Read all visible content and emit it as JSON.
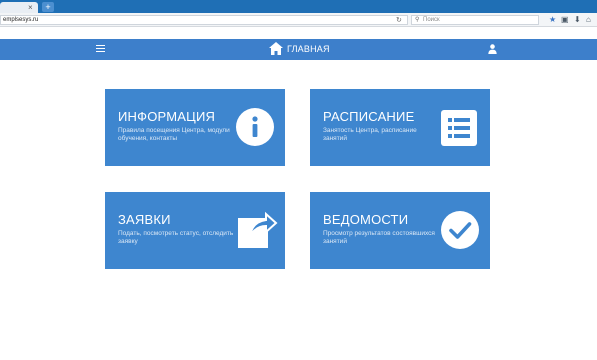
{
  "browser": {
    "tab_close": "×",
    "new_tab": "+",
    "url": "emplsesys.ru",
    "search_placeholder": "Поиск",
    "reload": "↻"
  },
  "header": {
    "title": "ГЛАВНАЯ",
    "menu_icon": "hamburger-icon",
    "home_icon": "home-icon",
    "user_icon": "user-icon"
  },
  "cards": [
    {
      "title": "ИНФОРМАЦИЯ",
      "description": "Правила посещения Центра, модули обучения, контакты",
      "icon": "info-icon"
    },
    {
      "title": "РАСПИСАНИЕ",
      "description": "Занятость Центра, расписание занятий",
      "icon": "list-icon"
    },
    {
      "title": "ЗАЯВКИ",
      "description": "Подать, посмотреть статус, отследить заявку",
      "icon": "share-icon"
    },
    {
      "title": "ВЕДОМОСТИ",
      "description": "Просмотр результатов состоявшихся занятий",
      "icon": "check-icon"
    }
  ],
  "colors": {
    "header": "#3d7fcb",
    "card": "#3e86cf",
    "tabstrip": "#1f6fb5"
  }
}
